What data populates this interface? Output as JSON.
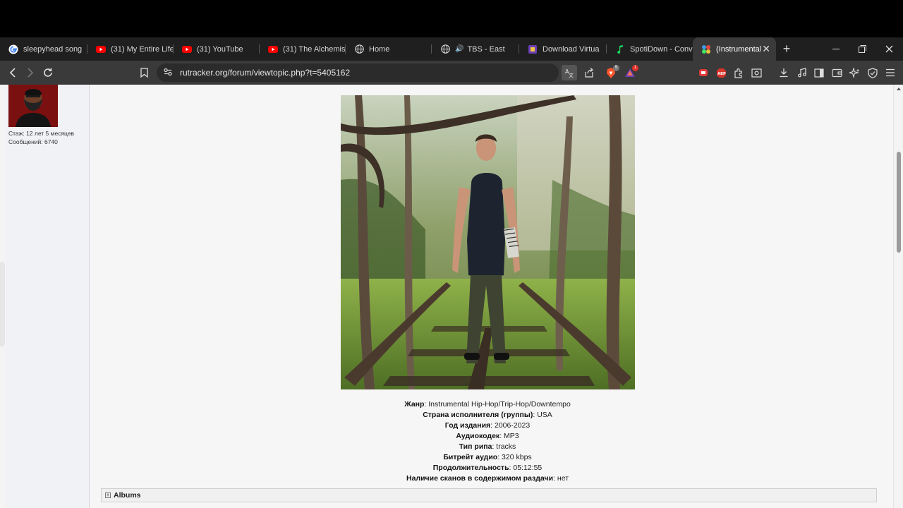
{
  "browser": {
    "tabs": [
      {
        "label": "sleepyhead song",
        "icon": "google-icon"
      },
      {
        "label": "(31) My Entire Life",
        "icon": "youtube-icon"
      },
      {
        "label": "(31) YouTube",
        "icon": "youtube-icon"
      },
      {
        "label": "(31) The Alchemist",
        "icon": "youtube-icon"
      },
      {
        "label": "Home",
        "icon": "globe-icon"
      },
      {
        "label": "TBS - East",
        "icon": "globe-icon"
      },
      {
        "label": "Download Virtua",
        "icon": "download-site-icon"
      },
      {
        "label": "SpotiDown - Conv",
        "icon": "music-note-icon"
      },
      {
        "label": "(Instrumental",
        "icon": "active-tab-icon"
      }
    ],
    "address": "rutracker.org/forum/viewtopic.php?t=5405162",
    "notification_badge": "1",
    "shield_badge": "5"
  },
  "user": {
    "stazh": "Стаж: 12 лет 5 месяцев",
    "messages": "Сообщений: 6740"
  },
  "release": {
    "rows": [
      {
        "label": "Жанр",
        "value": "Instrumental Hip-Hop/Trip-Hop/Downtempo"
      },
      {
        "label": "Страна исполнителя (группы)",
        "value": "USA"
      },
      {
        "label": "Год издания",
        "value": "2006-2023"
      },
      {
        "label": "Аудиокодек",
        "value": "MP3"
      },
      {
        "label": "Тип рипа",
        "value": "tracks"
      },
      {
        "label": "Битрейт аудио",
        "value": "320 kbps"
      },
      {
        "label": "Продолжительность",
        "value": "05:12:55"
      },
      {
        "label": "Наличие сканов в содержимом раздачи",
        "value": "нет"
      }
    ],
    "colon": ": ",
    "albums_label": "Albums"
  }
}
